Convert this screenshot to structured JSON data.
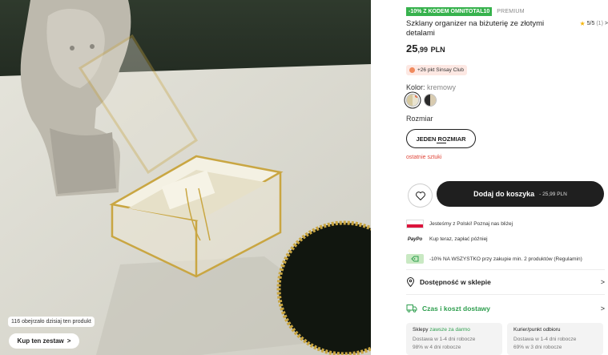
{
  "photo": {
    "viewers_text": "116 obejrzało dzisiaj ten produkt",
    "shop_look_label": "Kup ten zestaw",
    "shop_look_arrow": ">"
  },
  "product": {
    "promo_badge": "-10% Z KODEM OMNITOTAL10",
    "premium_label": "PREMIUM",
    "name": "Szklany organizer na biżuterię ze złotymi detalami",
    "rating_score": "5/5",
    "rating_count": "(1)",
    "rating_arrow": ">",
    "price_int": "25",
    "price_dec": ",99",
    "price_currency": "PLN",
    "club_badge": "+26 pkt Sinsay Club",
    "color_label": "Kolor:",
    "color_value": "kremowy",
    "swatches": [
      {
        "name": "kremowy",
        "left": "#d6c9a0",
        "right": "#e9e3cf",
        "selected": true
      },
      {
        "name": "czarny",
        "left": "#2a2a2a",
        "right": "#d8cbb0",
        "selected": false
      }
    ],
    "size_label": "Rozmiar",
    "size_value": "JEDEN ROZMIAR",
    "stock_note": "ostatnie sztuki",
    "add_to_cart_label": "Dodaj do koszyka",
    "add_to_cart_price": "- 25,99 PLN"
  },
  "info": {
    "poland_text": "Jesteśmy z Polski! Poznaj nas bliżej",
    "paypo_logo": "PayPo",
    "paypo_text": "Kup teraz, zapłać później",
    "promo_text": "-10% NA WSZYSTKO przy zakupie min. 2 produktów (Regulamin)"
  },
  "sections": {
    "availability_label": "Dostępność w sklepie",
    "delivery_label": "Czas i koszt dostawy",
    "chevron": ">"
  },
  "delivery_cards": [
    {
      "title": "Sklepy",
      "title_extra": "zawsze za darmo",
      "line1": "Dostawa w 1-4 dni robocze",
      "line2": "98% w 4 dni robocze"
    },
    {
      "title": "Kurier/punkt odbioru",
      "title_extra": "",
      "line1": "Dostawa w 1-4 dni robocze",
      "line2": "69% w 3 dni robocze"
    }
  ],
  "colors": {
    "promo_green": "#37b24d",
    "delivery_green": "#2e9e4e",
    "stock_red": "#e0473a",
    "button_dark": "#1f1f1f"
  }
}
